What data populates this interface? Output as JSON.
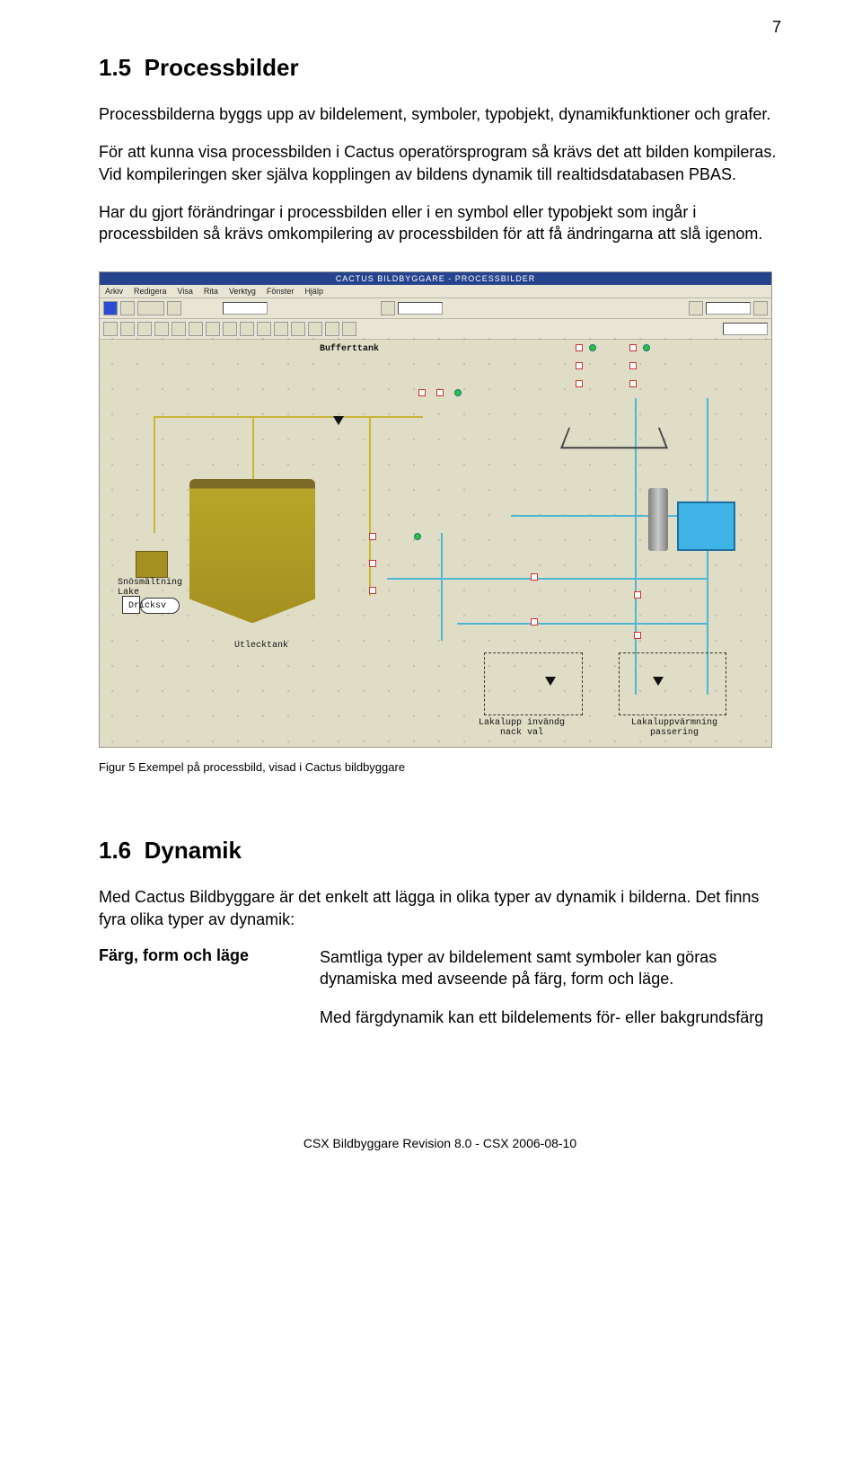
{
  "page_number": "7",
  "section1": {
    "number": "1.5",
    "title": "Processbilder",
    "p1": "Processbilderna byggs upp av bildelement, symboler, typobjekt, dynamikfunktioner och grafer.",
    "p2": "För att kunna visa processbilden i Cactus operatörsprogram så krävs det att bilden kompileras. Vid kompileringen sker själva kopplingen av bildens dynamik till realtidsdatabasen PBAS.",
    "p3": "Har du gjort förändringar i processbilden eller i en symbol eller typobjekt som ingår i processbilden så krävs omkompilering av processbilden för att få ändringarna att slå igenom."
  },
  "screenshot": {
    "title": "CACTUS BILDBYGGARE - PROCESSBILDER",
    "menu": [
      "Arkiv",
      "Redigera",
      "Visa",
      "Rita",
      "Verktyg",
      "Fönster",
      "Hjälp"
    ],
    "canvas_labels": {
      "bufferttank": "Bufferttank",
      "utlecktank": "Utlecktank",
      "snosmaltning": "Snösmältning\nLake",
      "dricksv": "Dricksv",
      "bottom_left": "Lakalupp invändg\nnack val",
      "bottom_right": "Lakaluppvärmning\npassering"
    }
  },
  "figure_caption": "Figur 5 Exempel på processbild, visad i Cactus bildbyggare",
  "section2": {
    "number": "1.6",
    "title": "Dynamik",
    "p1": "Med Cactus Bildbyggare är det enkelt att lägga in olika typer av dynamik i bilderna. Det finns fyra olika typer av dynamik:",
    "row_label": "Färg, form och läge",
    "row_desc1": "Samtliga typer av bildelement samt symboler kan göras dynamiska med avseende på färg, form och läge.",
    "row_desc2": "Med färgdynamik kan ett bildelements för- eller bakgrundsfärg"
  },
  "footer": "CSX Bildbyggare Revision 8.0 - CSX 2006-08-10"
}
